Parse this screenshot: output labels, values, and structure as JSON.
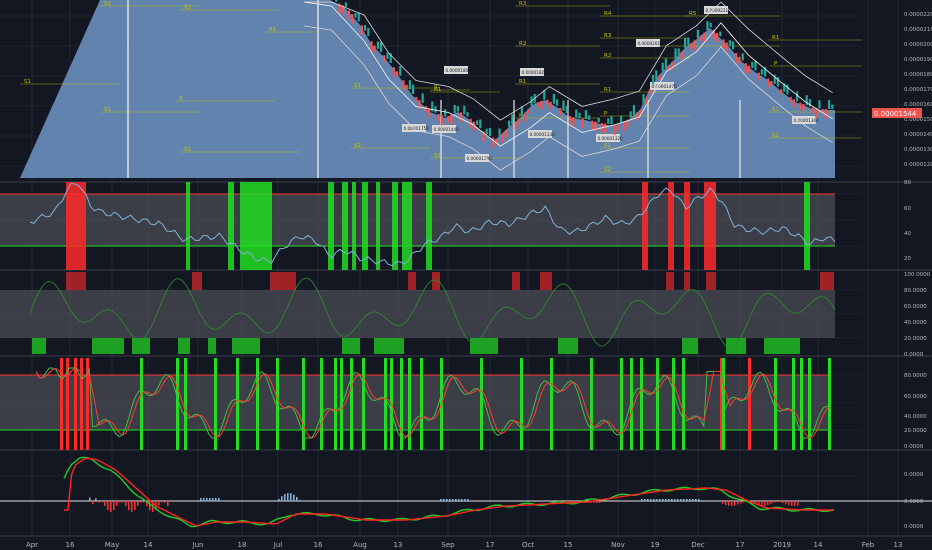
{
  "theme": {
    "background": "#131722",
    "price_fill": "#6b8fbd",
    "grid": "#2a2e39",
    "axis_text": "#b2b5be",
    "pivot_line": "#c6c600",
    "pivot_label": "#c6c600",
    "bull": "#26a69a",
    "bear": "#ef5350",
    "signal_red": "#ff2a2a",
    "signal_green": "#22dd22",
    "band_fill": "#5d5f66",
    "rsi_line": "#7fb2d6",
    "stoch_k": "#3fbf3f",
    "stoch_d": "#ff3a3a",
    "macd_line": "#22cc22",
    "macd_signal": "#ff2222",
    "price_badge": "#ef5350"
  },
  "x_axis": {
    "labels": [
      "Apr",
      "16",
      "May",
      "14",
      "Jun",
      "18",
      "Jul",
      "16",
      "Aug",
      "13",
      "Sep",
      "17",
      "Oct",
      "15",
      "Nov",
      "19",
      "Dec",
      "17",
      "2019",
      "14",
      "Feb",
      "13"
    ]
  },
  "price_panel": {
    "current_price": "0.00001544",
    "y_ticks": [
      "0.00002200",
      "0.00002100",
      "0.00002000",
      "0.00001900",
      "0.00001800",
      "0.00001700",
      "0.00001600",
      "0.00001500",
      "0.00001400",
      "0.00001300",
      "0.00001200"
    ],
    "pivot_labels": [
      "S2",
      "S2",
      "R1",
      "S1",
      "S1",
      "P",
      "S1",
      "R1",
      "S2",
      "S1",
      "S2",
      "R3",
      "R4",
      "R5",
      "R2",
      "R2",
      "P",
      "R1",
      "P",
      "P",
      "R1",
      "R2",
      "R3",
      "P",
      "R1",
      "S1",
      "S2",
      "S1",
      "S2"
    ],
    "price_tags": [
      "0.00002210",
      "0.00002010",
      "0.00001820",
      "0.00001800",
      "0.00001750",
      "0.00001440",
      "0.00001390",
      "0.00001330",
      "0.00001320",
      "0.00001300",
      "0.00001470"
    ]
  },
  "rsi_panel": {
    "y_ticks": [
      "80",
      "60",
      "40",
      "20"
    ]
  },
  "stoch_panel": {
    "y_ticks": [
      "100.0000",
      "80.0000",
      "60.0000",
      "40.0000",
      "20.0000",
      "0.0000"
    ]
  },
  "stoch2_panel": {
    "y_ticks": [
      "80.0000",
      "60.0000",
      "40.0000",
      "20.0000",
      "0.0000"
    ]
  },
  "macd_panel": {
    "y_ticks": [
      "0.0000",
      "0.0000",
      "0.0000"
    ]
  },
  "chart_data": {
    "type": "line",
    "title": "",
    "xlabel": "",
    "ylabel": "",
    "x_range": [
      "2018-04-01",
      "2019-02-13"
    ],
    "ylim": [
      1.15e-05,
      2.32e-05
    ],
    "grid": true,
    "series": [
      {
        "x": [
          "2018-07-10",
          "2018-07-20",
          "2018-08-01",
          "2018-08-10",
          "2018-08-20",
          "2018-09-01",
          "2018-09-10",
          "2018-09-20",
          "2018-10-01",
          "2018-10-08",
          "2018-10-20",
          "2018-11-01",
          "2018-11-10",
          "2018-11-20",
          "2018-12-01",
          "2018-12-10",
          "2018-12-20",
          "2019-01-01",
          "2019-01-10",
          "2019-01-20"
        ],
        "values": [
          2.35e-05,
          2.28e-05,
          2.05e-05,
          1.8e-05,
          1.62e-05,
          1.58e-05,
          1.5e-05,
          1.36e-05,
          1.48e-05,
          1.58e-05,
          1.45e-05,
          1.5e-05,
          1.55e-05,
          1.85e-05,
          1.98e-05,
          2.17e-05,
          1.96e-05,
          1.78e-05,
          1.65e-05,
          1.54e-05
        ]
      }
    ]
  }
}
